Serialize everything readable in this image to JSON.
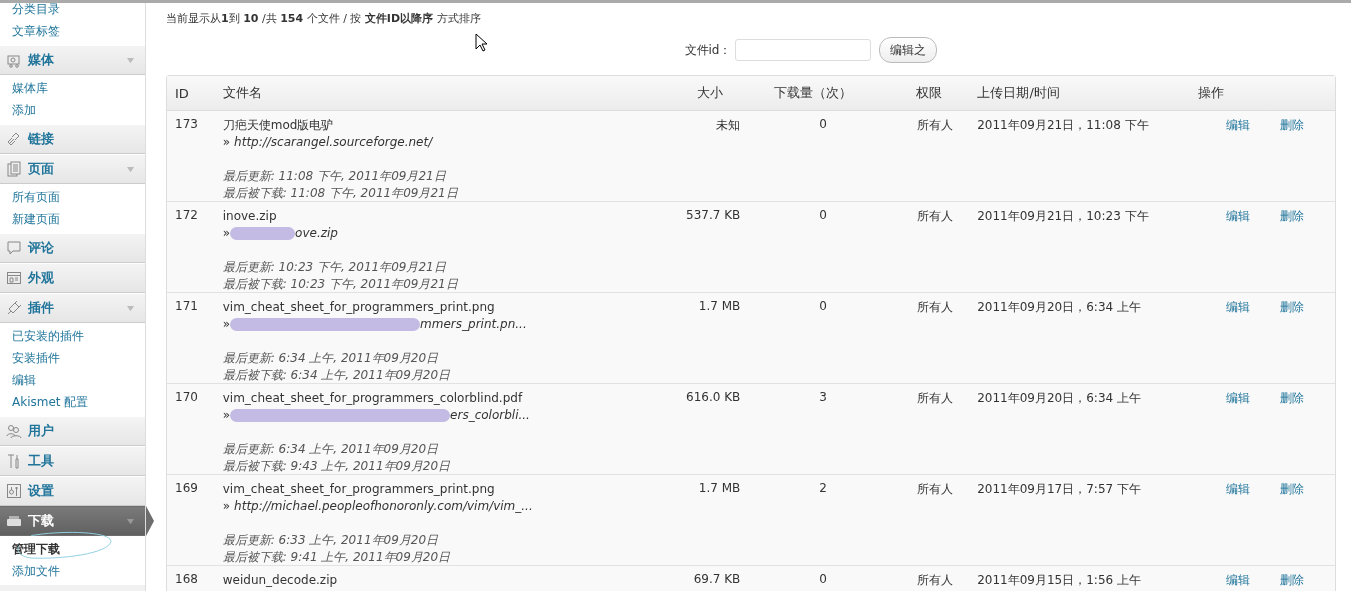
{
  "sidebar": {
    "top_items": [
      {
        "label": "分类目录",
        "selected": false
      },
      {
        "label": "文章标签",
        "selected": false
      }
    ],
    "menus": [
      {
        "label": "媒体",
        "expanded": true,
        "selected": false,
        "items": [
          {
            "label": "媒体库",
            "selected": false
          },
          {
            "label": "添加",
            "selected": false
          }
        ]
      },
      {
        "label": "链接",
        "expanded": false,
        "selected": false
      },
      {
        "label": "页面",
        "expanded": true,
        "selected": false,
        "items": [
          {
            "label": "所有页面",
            "selected": false
          },
          {
            "label": "新建页面",
            "selected": false
          }
        ]
      },
      {
        "label": "评论",
        "expanded": false,
        "selected": false
      },
      {
        "label": "外观",
        "expanded": false,
        "selected": false
      },
      {
        "label": "插件",
        "expanded": true,
        "selected": false,
        "items": [
          {
            "label": "已安装的插件",
            "selected": false
          },
          {
            "label": "安装插件",
            "selected": false
          },
          {
            "label": "编辑",
            "selected": false
          },
          {
            "label": "Akismet 配置",
            "selected": false
          }
        ]
      },
      {
        "label": "用户",
        "expanded": false,
        "selected": false
      },
      {
        "label": "工具",
        "expanded": false,
        "selected": false
      },
      {
        "label": "设置",
        "expanded": false,
        "selected": false
      },
      {
        "label": "下载",
        "expanded": true,
        "selected": true,
        "items": [
          {
            "label": "管理下载",
            "selected": true
          },
          {
            "label": "添加文件",
            "selected": false
          }
        ]
      }
    ]
  },
  "summary": "当前显示从**1**到 **10** /共 **154** 个文件 / 按 **文件ID以降序** 方式排序",
  "file_id_field": {
    "label": "文件id：",
    "button": "编辑之"
  },
  "table": {
    "columns": [
      "ID",
      "文件名",
      "大小",
      "下载量（次）",
      "权限",
      "上传日期/时间",
      "操作"
    ],
    "rows": [
      {
        "id": "173",
        "name": "刀疤天使mod版电驴",
        "url_prefix": "»",
        "redacted": false,
        "url": "http://scarangel.sourceforge.net/",
        "updated": "最后更新: 11:08 下午, 2011年09月21日",
        "downloaded": "最后被下载: 11:08 下午, 2011年09月21日",
        "size": "未知",
        "downloads": "0",
        "permission": "所有人",
        "date": "2011年09月21日，11:08 下午",
        "edit": "编辑",
        "delete": "删除"
      },
      {
        "id": "172",
        "name": "inove.zip",
        "url_prefix": "»",
        "redacted": true,
        "url": "ove.zip",
        "updated": "最后更新: 10:23 下午, 2011年09月21日",
        "downloaded": "最后被下载: 10:23 下午, 2011年09月21日",
        "size": "537.7 KB",
        "downloads": "0",
        "permission": "所有人",
        "date": "2011年09月21日，10:23 下午",
        "edit": "编辑",
        "delete": "删除"
      },
      {
        "id": "171",
        "name": "vim_cheat_sheet_for_programmers_print.png",
        "url_prefix": "»",
        "redacted": true,
        "url": "mmers_print.pn...",
        "updated": "最后更新: 6:34 上午, 2011年09月20日",
        "downloaded": "最后被下载: 6:34 上午, 2011年09月20日",
        "size": "1.7 MB",
        "downloads": "0",
        "permission": "所有人",
        "date": "2011年09月20日，6:34 上午",
        "edit": "编辑",
        "delete": "删除"
      },
      {
        "id": "170",
        "name": "vim_cheat_sheet_for_programmers_colorblind.pdf",
        "url_prefix": "»",
        "redacted": true,
        "url": "ers_colorbli...",
        "updated": "最后更新: 6:34 上午, 2011年09月20日",
        "downloaded": "最后被下载: 9:43 上午, 2011年09月20日",
        "size": "616.0 KB",
        "downloads": "3",
        "permission": "所有人",
        "date": "2011年09月20日，6:34 上午",
        "edit": "编辑",
        "delete": "删除"
      },
      {
        "id": "169",
        "name": "vim_cheat_sheet_for_programmers_print.png",
        "url_prefix": "»",
        "redacted": false,
        "url": "http://michael.peopleofhonoronly.com/vim/vim_...",
        "updated": "最后更新: 6:33 上午, 2011年09月20日",
        "downloaded": "最后被下载: 9:41 上午, 2011年09月20日",
        "size": "1.7 MB",
        "downloads": "2",
        "permission": "所有人",
        "date": "2011年09月17日，7:57 下午",
        "edit": "编辑",
        "delete": "删除"
      },
      {
        "id": "168",
        "name": "weidun_decode.zip",
        "size": "69.7 KB",
        "downloads": "0",
        "permission": "所有人",
        "date": "2011年09月15日，1:56 上午",
        "edit": "编辑",
        "delete": "删除"
      }
    ]
  }
}
